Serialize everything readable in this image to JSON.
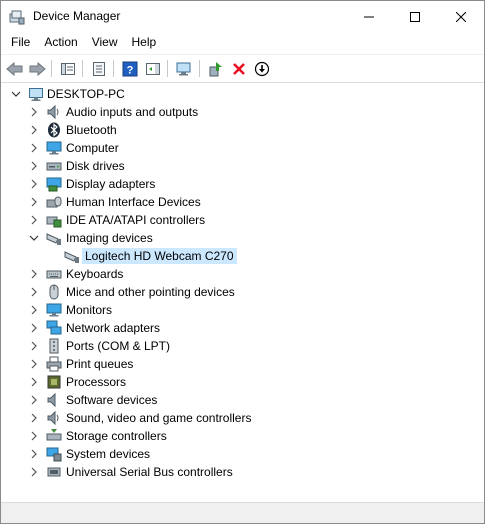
{
  "window": {
    "title": "Device Manager",
    "controls": {
      "minimize": "minimize",
      "maximize": "maximize",
      "close": "close"
    }
  },
  "menu": [
    "File",
    "Action",
    "View",
    "Help"
  ],
  "toolbar": [
    "back-arrow-icon",
    "forward-arrow-icon",
    "show-hide-console-tree-icon",
    "properties-icon",
    "help-icon",
    "action-pane-icon",
    "scan-hardware-icon",
    "update-driver-icon",
    "uninstall-device-icon",
    "disable-device-icon"
  ],
  "tree": {
    "root": "DESKTOP-PC",
    "categories": [
      {
        "label": "Audio inputs and outputs",
        "icon": "speaker-icon",
        "expanded": false
      },
      {
        "label": "Bluetooth",
        "icon": "bluetooth-icon",
        "expanded": false
      },
      {
        "label": "Computer",
        "icon": "computer-icon",
        "expanded": false
      },
      {
        "label": "Disk drives",
        "icon": "disk-drive-icon",
        "expanded": false
      },
      {
        "label": "Display adapters",
        "icon": "display-adapter-icon",
        "expanded": false
      },
      {
        "label": "Human Interface Devices",
        "icon": "hid-icon",
        "expanded": false
      },
      {
        "label": "IDE ATA/ATAPI controllers",
        "icon": "ide-controller-icon",
        "expanded": false
      },
      {
        "label": "Imaging devices",
        "icon": "camera-icon",
        "expanded": true,
        "children": [
          {
            "label": "Logitech HD Webcam C270",
            "icon": "webcam-icon",
            "selected": true
          }
        ]
      },
      {
        "label": "Keyboards",
        "icon": "keyboard-icon",
        "expanded": false
      },
      {
        "label": "Mice and other pointing devices",
        "icon": "mouse-icon",
        "expanded": false
      },
      {
        "label": "Monitors",
        "icon": "monitor-icon",
        "expanded": false
      },
      {
        "label": "Network adapters",
        "icon": "network-adapter-icon",
        "expanded": false
      },
      {
        "label": "Ports (COM & LPT)",
        "icon": "port-icon",
        "expanded": false
      },
      {
        "label": "Print queues",
        "icon": "printer-icon",
        "expanded": false
      },
      {
        "label": "Processors",
        "icon": "processor-icon",
        "expanded": false
      },
      {
        "label": "Software devices",
        "icon": "software-device-icon",
        "expanded": false
      },
      {
        "label": "Sound, video and game controllers",
        "icon": "sound-icon",
        "expanded": false
      },
      {
        "label": "Storage controllers",
        "icon": "storage-controller-icon",
        "expanded": false
      },
      {
        "label": "System devices",
        "icon": "system-device-icon",
        "expanded": false
      },
      {
        "label": "Universal Serial Bus controllers",
        "icon": "usb-icon",
        "expanded": false
      }
    ]
  },
  "colors": {
    "selection": "#cce8ff",
    "accent_blue": "#1e73c8",
    "uninstall_red": "#e81123"
  }
}
